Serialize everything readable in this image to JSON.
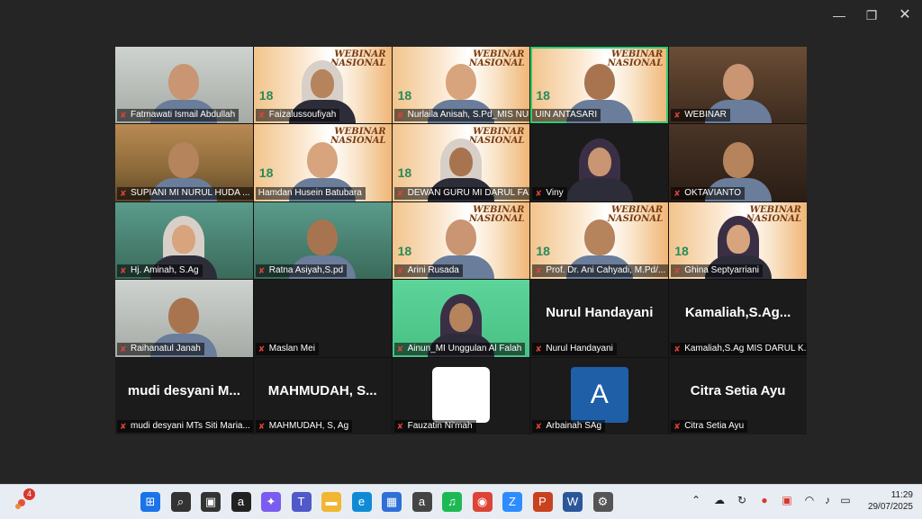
{
  "window": {
    "minimize_icon": "minimize-icon",
    "restore_icon": "restore-icon",
    "close_icon": "close-icon"
  },
  "participants": [
    {
      "name": "Fatmawati Ismail Abdullah",
      "bg": "wall",
      "muted": true
    },
    {
      "name": "Faizalussoufiyah",
      "bg": "banner",
      "muted": true
    },
    {
      "name": "Nurlaila Anisah, S.Pd_MIS NURUL...",
      "bg": "banner",
      "muted": true
    },
    {
      "name": "UIN ANTASARI",
      "bg": "banner",
      "muted": false,
      "active": true
    },
    {
      "name": "WEBINAR",
      "bg": "shelf",
      "muted": true
    },
    {
      "name": "SUPIANI MI NURUL HUDA ...",
      "bg": "room",
      "muted": true
    },
    {
      "name": "Hamdan Husein Batubara",
      "bg": "banner",
      "muted": false
    },
    {
      "name": "DEWAN GURU MI DARUL FA...",
      "bg": "banner",
      "muted": true
    },
    {
      "name": "Viny",
      "bg": "dark",
      "muted": true
    },
    {
      "name": "OKTAVIANTO",
      "bg": "office",
      "muted": true
    },
    {
      "name": "Hj. Aminah, S.Ag",
      "bg": "class",
      "muted": true
    },
    {
      "name": "Ratna Asiyah,S.pd",
      "bg": "class",
      "muted": true
    },
    {
      "name": "Arini Rusada",
      "bg": "banner",
      "muted": true
    },
    {
      "name": "Prof. Dr. Ani Cahyadi, M.Pd/...",
      "bg": "banner",
      "muted": true
    },
    {
      "name": "Ghina Septyarriani",
      "bg": "banner",
      "muted": true
    },
    {
      "name": "Raihanatul Janah",
      "bg": "wall",
      "muted": true
    },
    {
      "name": "Maslan Mei",
      "bg": "dark",
      "muted": true,
      "no_video": true
    },
    {
      "name": "Ainun_MI Unggulan Al Falah",
      "bg": "green",
      "muted": true
    },
    {
      "name": "Nurul Handayani",
      "bg": "dark",
      "muted": true,
      "no_video": true,
      "display_name": "Nurul Handayani"
    },
    {
      "name": "Kamaliah,S.Ag MIS DARUL K...",
      "bg": "dark",
      "muted": true,
      "no_video": true,
      "display_name": "Kamaliah,S.Ag..."
    },
    {
      "name": "mudi desyani MTs Siti Maria...",
      "bg": "dark",
      "muted": true,
      "no_video": true,
      "display_name": "mudi desyani M..."
    },
    {
      "name": "MAHMUDAH, S, Ag",
      "bg": "dark",
      "muted": true,
      "no_video": true,
      "display_name": "MAHMUDAH, S..."
    },
    {
      "name": "Fauzatin Ni'mah",
      "bg": "dark",
      "muted": true,
      "no_video": true,
      "white_box": true
    },
    {
      "name": "Arbainah SAg",
      "bg": "dark",
      "muted": true,
      "no_video": true,
      "avatar_letter": "A"
    },
    {
      "name": "Citra Setia Ayu",
      "bg": "dark",
      "muted": true,
      "no_video": true,
      "display_name": "Citra Setia Ayu"
    }
  ],
  "banner": {
    "webinar_line1": "WEBINAR",
    "webinar_line2": "NASIONAL",
    "badge": "18"
  },
  "taskbar": {
    "weather_badge": "4",
    "apps": [
      {
        "icon": "windows-start-icon",
        "color": "#1a73e8"
      },
      {
        "icon": "search-icon",
        "color": "#333333"
      },
      {
        "icon": "task-view-icon",
        "color": "#333333"
      },
      {
        "icon": "amazon-icon",
        "color": "#222222"
      },
      {
        "icon": "copilot-icon",
        "color": "#7b5cf0"
      },
      {
        "icon": "teams-icon",
        "color": "#5059c9"
      },
      {
        "icon": "file-explorer-icon",
        "color": "#f2b632"
      },
      {
        "icon": "edge-icon",
        "color": "#0f8bd6"
      },
      {
        "icon": "store-icon",
        "color": "#2f6fd8"
      },
      {
        "icon": "amazon-icon",
        "color": "#444444"
      },
      {
        "icon": "spotify-icon",
        "color": "#1db954"
      },
      {
        "icon": "chrome-icon",
        "color": "#db4437"
      },
      {
        "icon": "zoom-icon",
        "color": "#2d8cff"
      },
      {
        "icon": "powerpoint-icon",
        "color": "#c8421e"
      },
      {
        "icon": "word-icon",
        "color": "#2b579a"
      },
      {
        "icon": "settings-icon",
        "color": "#555555"
      }
    ],
    "time": "11:29",
    "date": "29/07/2025"
  }
}
